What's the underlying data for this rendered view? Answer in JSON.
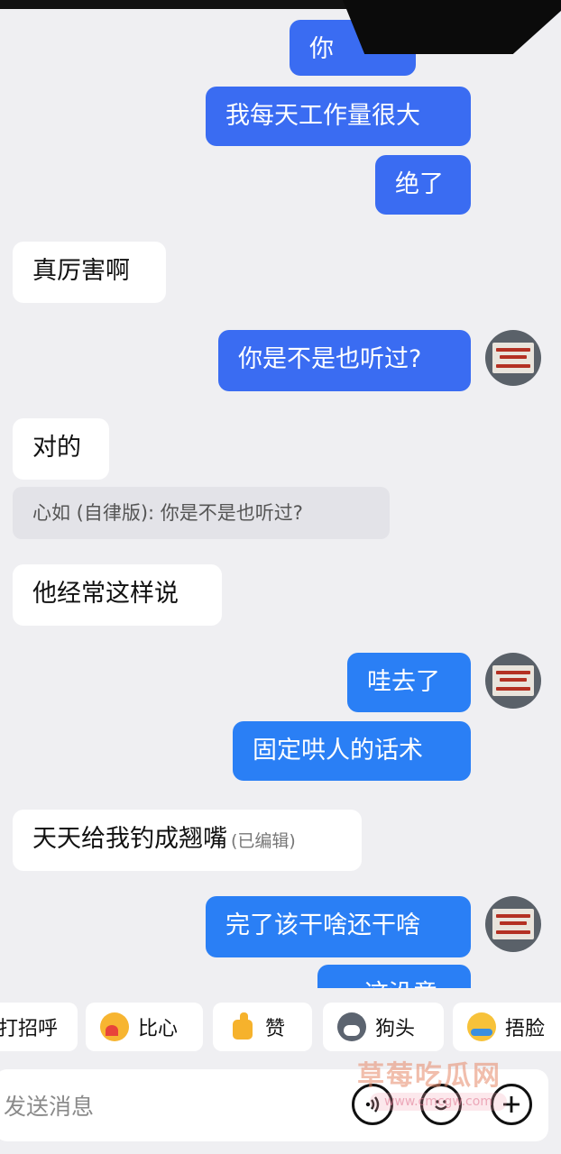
{
  "messages": {
    "m0": "你",
    "m1": "我每天工作量很大",
    "m2": "绝了",
    "m3": "真厉害啊",
    "m4": "你是不是也听过?",
    "m5": "对的",
    "quote": "心如 (自律版): 你是不是也听过?",
    "m6": "他经常这样说",
    "m7": "哇去了",
    "m8": "固定哄人的话术",
    "m9": "天天给我钓成翘嘴",
    "m9_edited": "(已编辑)",
    "m10": "完了该干啥还干啥",
    "m11": "这没意"
  },
  "quick_replies": [
    "打招呼",
    "比心",
    "赞",
    "狗头",
    "捂脸"
  ],
  "input": {
    "placeholder": "发送消息"
  },
  "watermark": {
    "text": "草莓吃瓜网",
    "url": "www.cmcgw.com"
  },
  "colors": {
    "outgoing": "#3a6cf2",
    "outgoing_alt": "#2a7ff5",
    "incoming": "#ffffff",
    "background": "#efeff2"
  }
}
